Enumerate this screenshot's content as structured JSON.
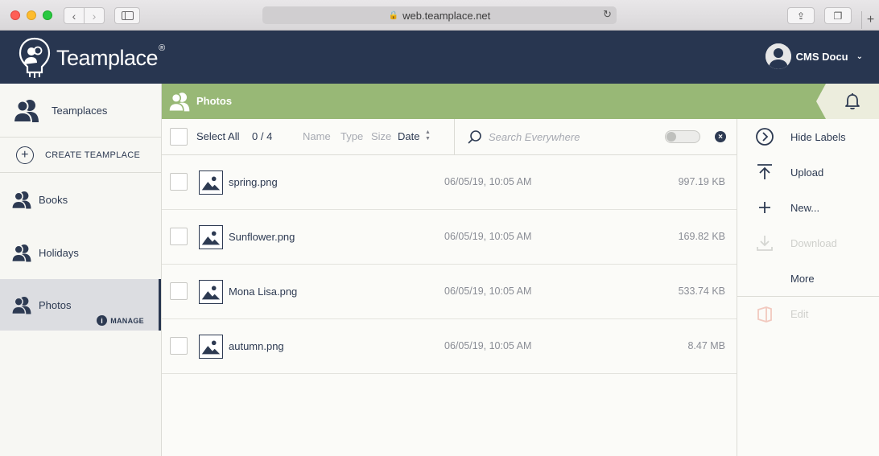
{
  "browser": {
    "url": "web.teamplace.net"
  },
  "header": {
    "brand": "Teamplace",
    "brand_mark": "®",
    "user_name": "CMS Docu"
  },
  "sidebar": {
    "teamplaces_label": "Teamplaces",
    "create_label": "CREATE TEAMPLACE",
    "items": [
      {
        "label": "Books"
      },
      {
        "label": "Holidays"
      },
      {
        "label": "Photos",
        "manage_label": "MANAGE",
        "selected": true
      }
    ]
  },
  "titlebar": {
    "title": "Photos"
  },
  "toolbar": {
    "select_all": "Select All",
    "count": "0 / 4",
    "sort_name": "Name",
    "sort_type": "Type",
    "sort_size": "Size",
    "sort_date": "Date",
    "search_placeholder": "Search Everywhere"
  },
  "files": [
    {
      "name": "spring.png",
      "date": "06/05/19, 10:05 AM",
      "size": "997.19 KB"
    },
    {
      "name": "Sunflower.png",
      "date": "06/05/19, 10:05 AM",
      "size": "169.82 KB"
    },
    {
      "name": "Mona Lisa.png",
      "date": "06/05/19, 10:05 AM",
      "size": "533.74 KB"
    },
    {
      "name": "autumn.png",
      "date": "06/05/19, 10:05 AM",
      "size": "8.47 MB"
    }
  ],
  "actions": {
    "hide_labels": "Hide Labels",
    "upload": "Upload",
    "new": "New...",
    "download": "Download",
    "more": "More",
    "edit": "Edit"
  },
  "colors": {
    "header_bg": "#283650",
    "accent_green": "#98b876",
    "selected_bg": "#dcdde1"
  }
}
